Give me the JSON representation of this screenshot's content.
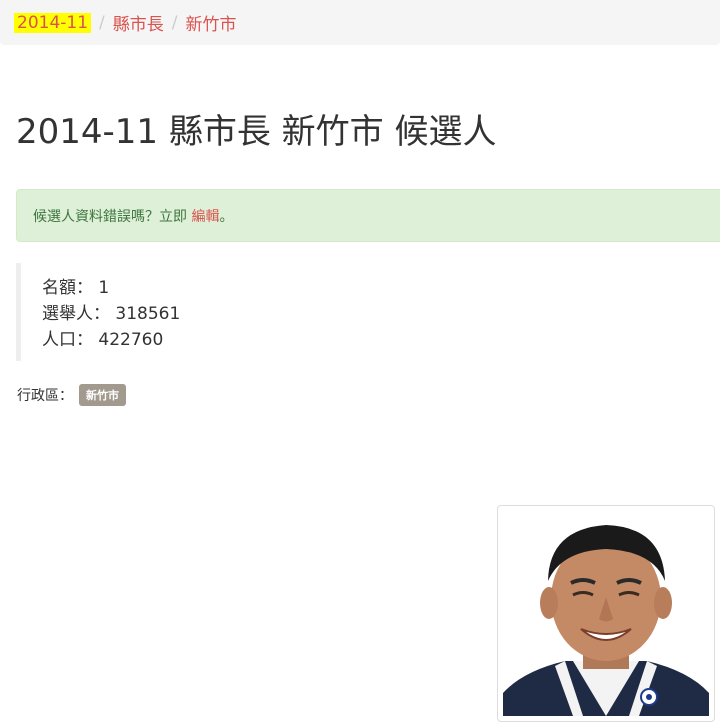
{
  "breadcrumb": {
    "items": [
      "2014-11",
      "縣市長",
      "新竹市"
    ],
    "separator": "/"
  },
  "page": {
    "title": "2014-11 縣市長 新竹市 候選人"
  },
  "alert": {
    "text": "候選人資料錯誤嗎？立即",
    "link": "編輯",
    "suffix": "。"
  },
  "stats": {
    "seats_label": "名額：",
    "seats_value": "1",
    "voters_label": "選舉人：",
    "voters_value": "318561",
    "population_label": "人口：",
    "population_value": "422760"
  },
  "district": {
    "label": "行政區：",
    "badge": "新竹市"
  },
  "colors": {
    "link": "#d9534f",
    "highlight": "#ffff00",
    "alert_bg": "#dff0d8",
    "alert_text": "#3c763d",
    "badge_bg": "#a39a8f"
  }
}
